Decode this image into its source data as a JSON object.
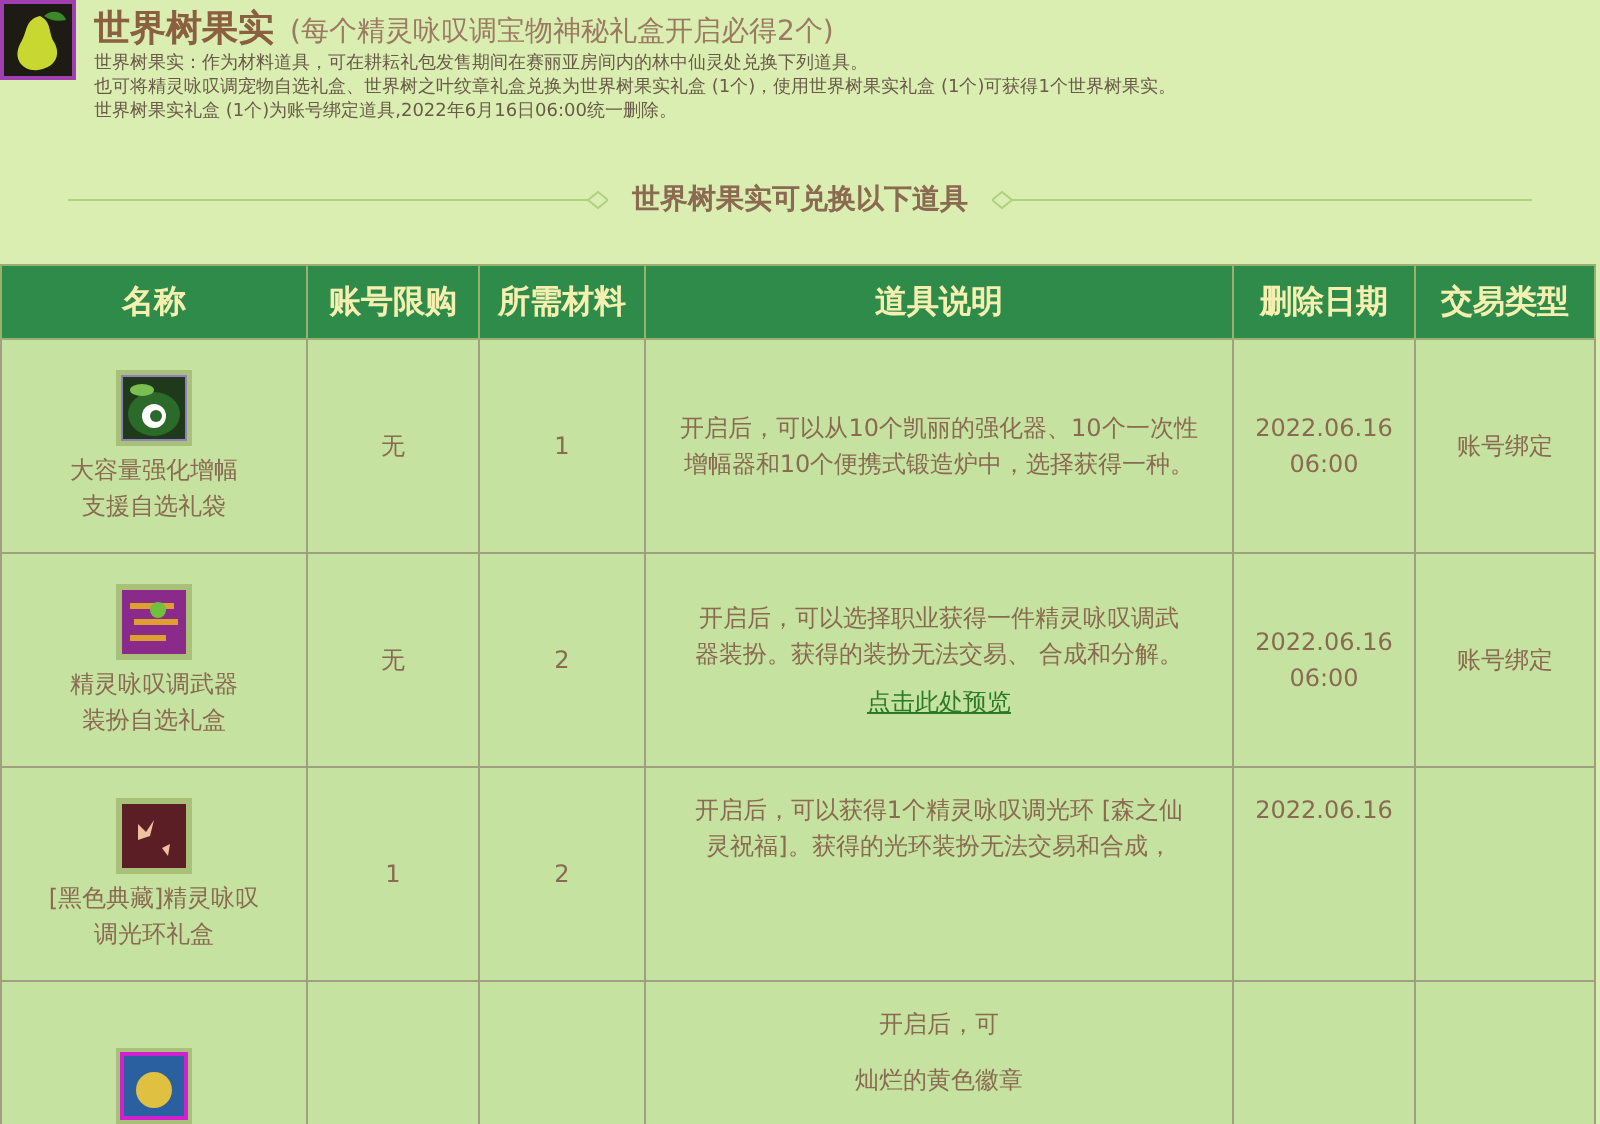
{
  "header": {
    "title": "世界树果实",
    "subtitle": "(每个精灵咏叹调宝物神秘礼盒开启必得2个)",
    "info": [
      "世界树果实：作为材料道具，可在耕耘礼包发售期间在赛丽亚房间内的林中仙灵处兑换下列道具。",
      "也可将精灵咏叹调宠物自选礼盒、世界树之叶纹章礼盒兑换为世界树果实礼盒 (1个)，使用世界树果实礼盒 (1个)可获得1个世界树果实。",
      "世界树果实礼盒 (1个)为账号绑定道具,2022年6月16日06:00统一删除。"
    ]
  },
  "section_title": "世界树果实可兑换以下道具",
  "table": {
    "columns": [
      "名称",
      "账号限购",
      "所需材料",
      "道具说明",
      "删除日期",
      "交易类型"
    ],
    "rows": [
      {
        "name": [
          "大容量强化增幅",
          "支援自选礼袋"
        ],
        "limit": "无",
        "material": "1",
        "desc": [
          [
            "开启后，可以从10个凯丽的强化器、10个一次性",
            "增幅器和10个便携式锻造炉中，选择获得一种。"
          ]
        ],
        "date": [
          "2022.06.16",
          "06:00"
        ],
        "trade": "账号绑定"
      },
      {
        "name": [
          "精灵咏叹调武器",
          "装扮自选礼盒"
        ],
        "limit": "无",
        "material": "2",
        "desc": [
          [
            "开启后，可以选择职业获得一件精灵咏叹调武",
            "器装扮。获得的装扮无法交易、 合成和分解。"
          ]
        ],
        "link": "点击此处预览",
        "date": [
          "2022.06.16",
          "06:00"
        ],
        "trade": "账号绑定"
      },
      {
        "name": [
          "[黑色典藏]精灵咏叹",
          "调光环礼盒"
        ],
        "limit": "1",
        "material": "2",
        "desc": [
          [
            "开启后，可以获得1个精灵咏叹调光环 [森之仙",
            "灵祝福]。获得的光环装扮无法交易和合成，"
          ]
        ],
        "date": [
          "2022.06.16"
        ]
      },
      {
        "name": [],
        "desc": [
          [
            "开启后，可"
          ],
          [
            "灿烂的黄色徽章"
          ]
        ]
      }
    ]
  }
}
